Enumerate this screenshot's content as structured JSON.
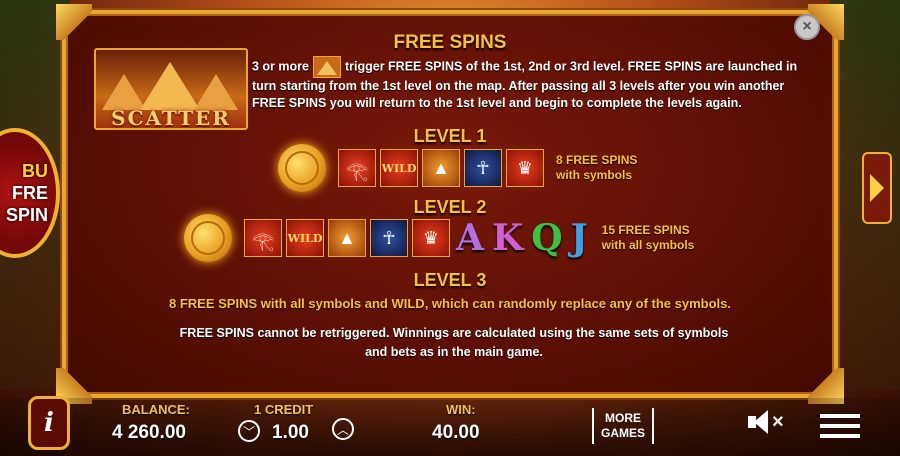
{
  "panel": {
    "close_symbol": "×",
    "free_spins_title": "FREE SPINS",
    "scatter_label": "SCATTER",
    "intro_prefix": "3 or more",
    "intro_text": "trigger FREE SPINS of the 1st, 2nd or 3rd level. FREE SPINS are launched in turn starting from the 1st level on the map. After passing all 3 levels after you win another FREE SPINS you will return to the 1st level and begin to complete the levels again.",
    "level1_title": "LEVEL 1",
    "level1_symbols": [
      "coin",
      "anubis",
      "wild",
      "jackal",
      "pharaoh",
      "cleopatra"
    ],
    "level1_note_line1": "8 FREE SPINS",
    "level1_note_line2": "with symbols",
    "level2_title": "LEVEL 2",
    "level2_symbols": [
      "coin",
      "anubis",
      "wild",
      "jackal",
      "pharaoh",
      "cleopatra"
    ],
    "level2_letters": [
      "A",
      "K",
      "Q",
      "J"
    ],
    "level2_note_line1": "15 FREE SPINS",
    "level2_note_line2": "with all symbols",
    "level3_title": "LEVEL 3",
    "level3_text": "8 FREE SPINS with all symbols and WILD, which can randomly replace any of the symbols.",
    "footer_line1": "FREE SPINS cannot be retriggered. Winnings are calculated using the same sets of symbols",
    "footer_line2": "and bets as in the main game.",
    "wild_label": "WILD"
  },
  "side_badge": [
    "BU",
    "FRE",
    "SPIN"
  ],
  "bottom": {
    "info_label": "i",
    "balance_label": "BALANCE:",
    "balance_value": "4 260.00",
    "credit_label": "1 CREDIT",
    "credit_value": "1.00",
    "win_label": "WIN:",
    "win_value": "40.00",
    "more_games_line1": "MORE",
    "more_games_line2": "GAMES",
    "decrease_symbol": "﹀",
    "increase_symbol": "︿",
    "mute_symbol": "×"
  },
  "icons": {
    "close": "close-icon",
    "info": "info-icon",
    "sound": "sound-muted-icon",
    "menu": "hamburger-menu-icon",
    "next": "chevron-right-icon"
  }
}
